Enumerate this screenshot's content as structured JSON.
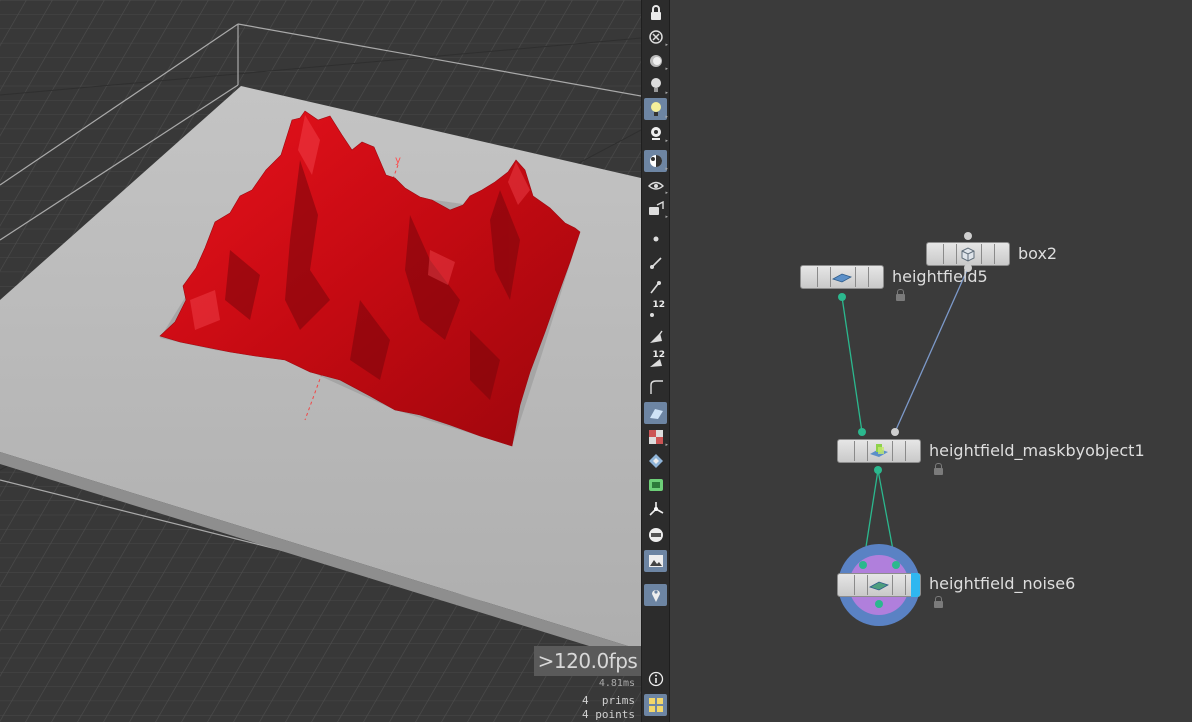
{
  "viewport": {
    "fps": ">120.0fps",
    "ms": "4.81ms",
    "prims_label": "4  prims",
    "points_label": "4 points",
    "axis_y_label": "y",
    "terrain_color": "#d40a12",
    "floor_color": "#b9b9b9"
  },
  "toolbar": {
    "icons": [
      "lock-icon",
      "ghost-icon",
      "sphere-shade-icon",
      "bulb-icon",
      "headlight-icon",
      "light-toggle-icon",
      "shading-mode-icon",
      "camera-icon",
      "camera-lock-icon",
      "point-icon",
      "edge-icon",
      "vertex-icon",
      "point-numbers-icon",
      "normals-icon",
      "primitive-numbers-icon",
      "curve-icon",
      "surface-icon",
      "checker-icon",
      "uv-icon",
      "uv-grid-icon",
      "edge-split-icon",
      "shelf-icon",
      "background-image-icon",
      "pin-icon",
      "info-icon",
      "layout-icon"
    ],
    "point_numbers_label": "12",
    "primitive_numbers_label": "12"
  },
  "network": {
    "nodes": {
      "box2": {
        "label": "box2"
      },
      "heightfield5": {
        "label": "heightfield5"
      },
      "maskbyobject": {
        "label": "heightfield_maskbyobject1"
      },
      "noise": {
        "label": "heightfield_noise6"
      }
    },
    "wire_colors": {
      "green": "#2bb88e",
      "blue": "#7c99c9"
    },
    "display_flag_color": "#2fb7f0"
  }
}
